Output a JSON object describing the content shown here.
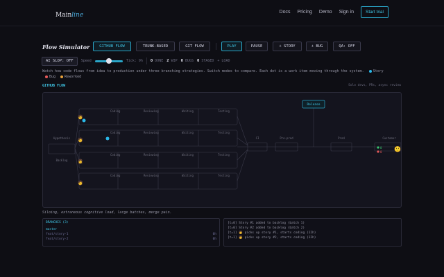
{
  "nav": {
    "logo_main": "Main",
    "logo_accent": "line",
    "links": [
      "Docs",
      "Pricing",
      "Demo",
      "Sign in"
    ],
    "cta": "Start trial"
  },
  "sim": {
    "title": "Flow Simulator",
    "buttons": [
      "GITHUB FLOW",
      "TRUNK-BASED",
      "GIT FLOW",
      "PLAY",
      "PAUSE",
      "+ STORY",
      "+ BUG",
      "QA: OFF"
    ],
    "ai_slop": "AI SLOP: OFF",
    "speed_label": "Speed",
    "tick_label": "Tick: 9h",
    "stats": [
      {
        "num": "0",
        "label": "DONE"
      },
      {
        "num": "2",
        "label": "WIP"
      },
      {
        "num": "0",
        "label": "BUGS"
      },
      {
        "num": "0",
        "label": "STAGED"
      },
      {
        "num": "",
        "label": "+ LOAD"
      }
    ],
    "description": "Watch how code flows from idea to production under three branching strategies. Switch modes to compare. Each dot is a work item moving through the system.",
    "legend": [
      {
        "label": "Story",
        "color": "#2ab8e8"
      },
      {
        "label": "Bug",
        "color": "#e85a5a"
      },
      {
        "label": "Reworked",
        "color": "#e8a23a"
      }
    ],
    "mode_label": "GITHUB FLOW",
    "mode_note": "Solo devs, PRs, async review",
    "caption": "Siloing, extraneous cognitive load, large batches, merge pain."
  },
  "diagram": {
    "release_label": "Release",
    "left_labels": [
      "Hypothesis",
      "Backlog"
    ],
    "pipeline_labels": [
      "CI",
      "Pre-prod",
      "Prod",
      "Customer"
    ],
    "stage_labels": [
      "Coding",
      "Reviewing",
      "Waiting",
      "Testing"
    ],
    "lane_icons": [
      "🧑",
      "🧑",
      "👩",
      "🧑"
    ],
    "customer_icon": "🙂",
    "customer_counts": [
      "0",
      "0"
    ]
  },
  "branches": {
    "header": "BRANCHES (3)",
    "rows": [
      {
        "name": "master",
        "count": ""
      },
      {
        "name": "feat/story-1",
        "count": "0h"
      },
      {
        "name": "feat/story-2",
        "count": "0h"
      }
    ]
  },
  "log": {
    "lines": [
      "[t=0] Story #1 added to backlog (batch 1)",
      "[t=0] Story #2 added to backlog (batch 2)",
      "[t=1] 🧑 picks up story #1, starts coding (12h)",
      "[t=1] 🧑 picks up story #2, starts coding (12h)"
    ]
  },
  "colors": {
    "accent": "#2aa6c8",
    "bg": "#0e0e14",
    "story": "#2ab8e8",
    "bug": "#e85a5a",
    "reworked": "#e8a23a",
    "customer_ok": "#3ac870",
    "customer_bad": "#e85a5a"
  }
}
